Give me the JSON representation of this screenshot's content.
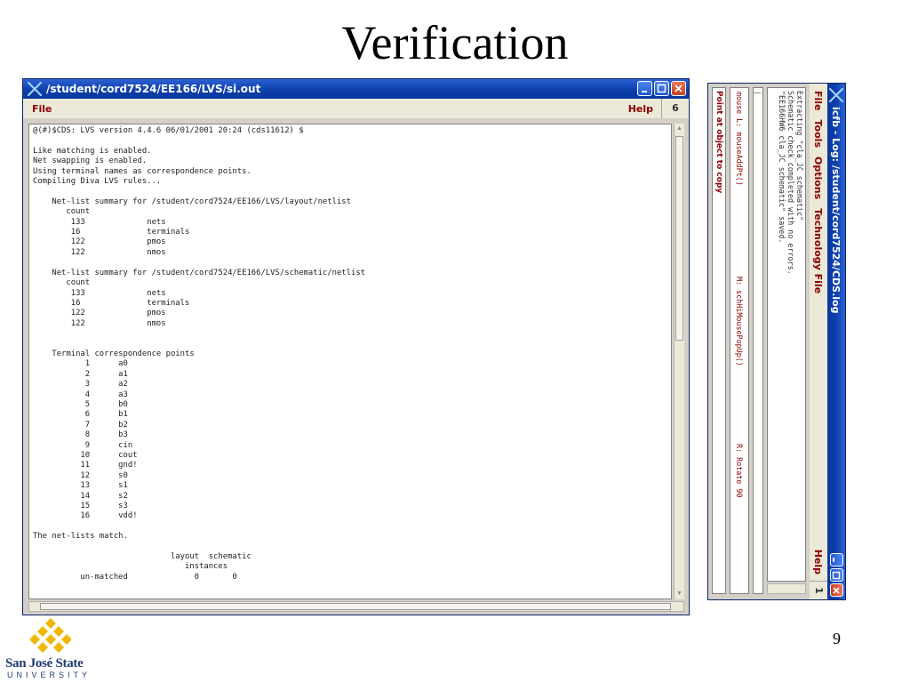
{
  "slide": {
    "title": "Verification",
    "page_number": "9"
  },
  "lvs_window": {
    "title": "/student/cord7524/EE166/LVS/si.out",
    "menu_file": "File",
    "menu_help": "Help",
    "window_number": "6",
    "content": "@(#)$CDS: LVS version 4.4.6 06/01/2001 20:24 (cds11612) $\n\nLike matching is enabled.\nNet swapping is enabled.\nUsing terminal names as correspondence points.\nCompiling Diva LVS rules...\n\n    Net-list summary for /student/cord7524/EE166/LVS/layout/netlist\n       count\n        133             nets\n        16              terminals\n        122             pmos\n        122             nmos\n\n    Net-list summary for /student/cord7524/EE166/LVS/schematic/netlist\n       count\n        133             nets\n        16              terminals\n        122             pmos\n        122             nmos\n\n\n    Terminal correspondence points\n           1      a0\n           2      a1\n           3      a2\n           4      a3\n           5      b0\n           6      b1\n           7      b2\n           8      b3\n           9      cin\n          10      cout\n          11      gnd!\n          12      s0\n          13      s1\n          14      s2\n          15      s3\n          16      vdd!\n\nThe net-lists match.\n\n                             layout  schematic\n                                instances\n          un-matched              0       0"
  },
  "log_window": {
    "title": "icfb - Log: /student/cord7524/CDS.log",
    "menu_items": [
      "File",
      "Tools",
      "Options",
      "Technology File"
    ],
    "menu_help": "Help",
    "window_number": "1",
    "log_text": "Extracting \"cla_JC schematic\"\nSchematic check completed with no errors.\n\"EE166HW6 cla_JC schematic\" saved.",
    "status_left": "mouse L: mouseAddPt()",
    "status_middle": "M: schHiMousePopUp()",
    "status_right": "R: Rotate 90",
    "prompt": "Point at object to copy"
  },
  "logo": {
    "name": "San José State",
    "university": "UNIVERSITY"
  },
  "colors": {
    "titlebar_blue": "#0b3fa8",
    "menu_text_red": "#8b0000",
    "logo_gold": "#f2b705",
    "logo_navy": "#1f3a72"
  }
}
